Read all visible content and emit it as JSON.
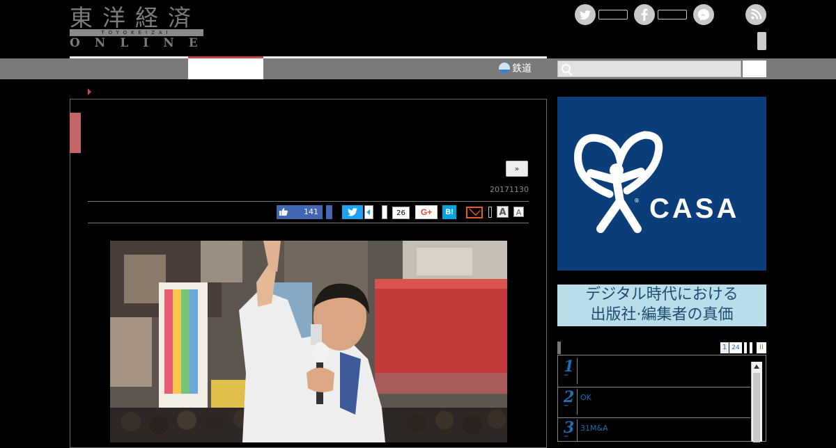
{
  "header": {
    "logo_kanji": "東洋経済",
    "logo_roman": "TOYOKEIZAI",
    "logo_online": "ONLINE"
  },
  "social": {
    "twitter_glyph": "t",
    "facebook_glyph": "f",
    "messenger_glyph": "m",
    "rss_glyph": "r"
  },
  "nav": {
    "rail_label": "鉄道"
  },
  "search": {
    "placeholder": ""
  },
  "article": {
    "next_label": "»",
    "date": "20171130"
  },
  "share": {
    "fb_count": "141",
    "tw_glyph": "t",
    "count": "26",
    "gplus_label": "G+",
    "hatena_label": "B!",
    "font_large": "A",
    "font_small": "A"
  },
  "ads": {
    "casa_text": "CASA",
    "casa_reg": "®",
    "banner_line1": "デジタル時代における",
    "banner_line2": "出版社·編集者の真価"
  },
  "ranking": {
    "tabs": [
      "1",
      "24",
      "",
      "",
      "II"
    ],
    "items": [
      {
        "num": "1",
        "title": ""
      },
      {
        "num": "2",
        "title": "OK"
      },
      {
        "num": "3",
        "title": "31M&A"
      }
    ]
  },
  "colors": {
    "accent_red": "#c54a4a",
    "link_blue": "#1a6fb5",
    "casa_blue": "#0a3d7a",
    "facebook": "#4267b2",
    "twitter": "#1da1f2"
  }
}
